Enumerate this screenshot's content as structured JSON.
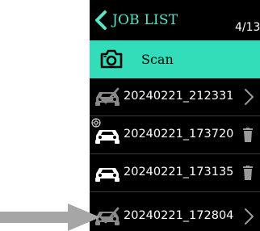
{
  "header": {
    "title": "JOB LIST",
    "counter": "4/13"
  },
  "scan": {
    "label": "Scan"
  },
  "jobs": [
    {
      "label": "20240221_212331",
      "status": "done",
      "action": "chevron"
    },
    {
      "label": "20240221_173720",
      "status": "pending",
      "action": "trash",
      "badge": true
    },
    {
      "label": "20240221_173135",
      "status": "pending",
      "action": "trash"
    },
    {
      "label": "20240221_172804",
      "status": "done",
      "action": "chevron"
    }
  ],
  "colors": {
    "accent": "#33ddba",
    "title": "#5de2c8",
    "background": "#000000",
    "arrow": "#a6a6a6"
  },
  "icons": {
    "back": "chevron-left-icon",
    "camera": "camera-icon",
    "car_done": "car-checked-icon",
    "car": "car-icon",
    "chevron": "chevron-right-icon",
    "trash": "trash-icon",
    "badge": "gear-badge-icon",
    "pointer": "arrow-right-icon"
  }
}
